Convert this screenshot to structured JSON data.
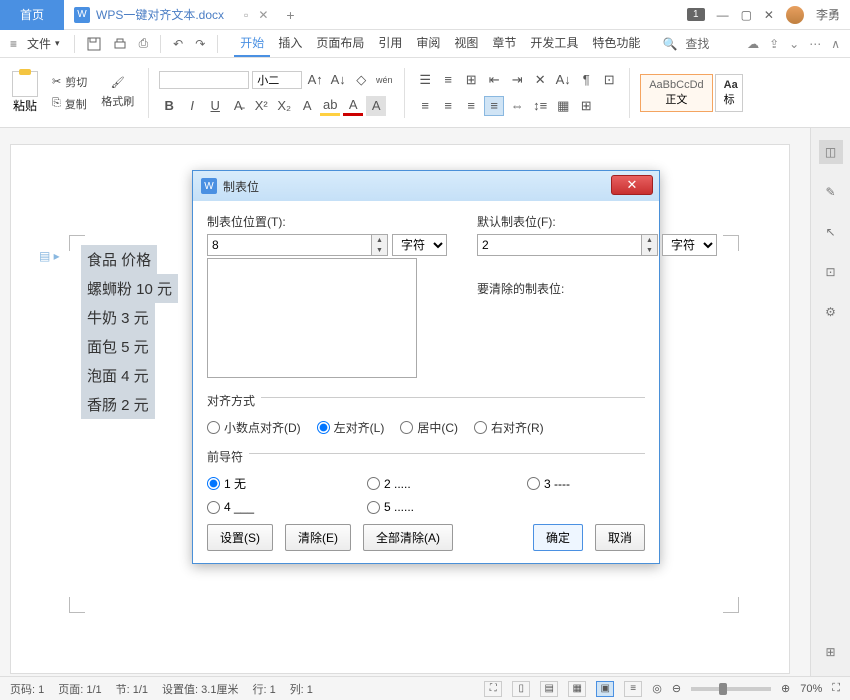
{
  "titlebar": {
    "home_tab": "首页",
    "doc_name": "WPS一键对齐文本.docx",
    "badge": "1",
    "username": "李勇"
  },
  "menubar": {
    "file": "文件",
    "tabs": [
      "开始",
      "插入",
      "页面布局",
      "引用",
      "审阅",
      "视图",
      "章节",
      "开发工具",
      "特色功能"
    ],
    "search": "查找"
  },
  "ribbon": {
    "paste": "粘贴",
    "cut": "剪切",
    "copy": "复制",
    "format_painter": "格式刷",
    "font_size": "小二",
    "style_normal_sample": "AaBbCcDd",
    "style_normal": "正文",
    "style_heading_sample": "Aa",
    "style_heading": "标"
  },
  "document": {
    "lines": [
      "食品 价格",
      "螺蛳粉 10 元",
      "牛奶 3 元",
      "面包 5 元",
      "泡面 4 元",
      "香肠 2 元"
    ]
  },
  "dialog": {
    "title": "制表位",
    "pos_label": "制表位位置(T):",
    "pos_value": "8",
    "pos_unit": "字符",
    "default_label": "默认制表位(F):",
    "default_value": "2",
    "default_unit": "字符",
    "clear_label": "要清除的制表位:",
    "align_label": "对齐方式",
    "align_options": [
      "小数点对齐(D)",
      "左对齐(L)",
      "居中(C)",
      "右对齐(R)"
    ],
    "align_selected": 1,
    "leader_label": "前导符",
    "leader_options": [
      "1 无",
      "2 .....",
      "3 ----",
      "4 ___",
      "5 ......"
    ],
    "leader_selected": 0,
    "btn_set": "设置(S)",
    "btn_clear": "清除(E)",
    "btn_clear_all": "全部清除(A)",
    "btn_ok": "确定",
    "btn_cancel": "取消"
  },
  "statusbar": {
    "page_no": "页码: 1",
    "page": "页面: 1/1",
    "section": "节: 1/1",
    "set_value": "设置值: 3.1厘米",
    "line": "行: 1",
    "col": "列: 1",
    "zoom": "70%"
  }
}
